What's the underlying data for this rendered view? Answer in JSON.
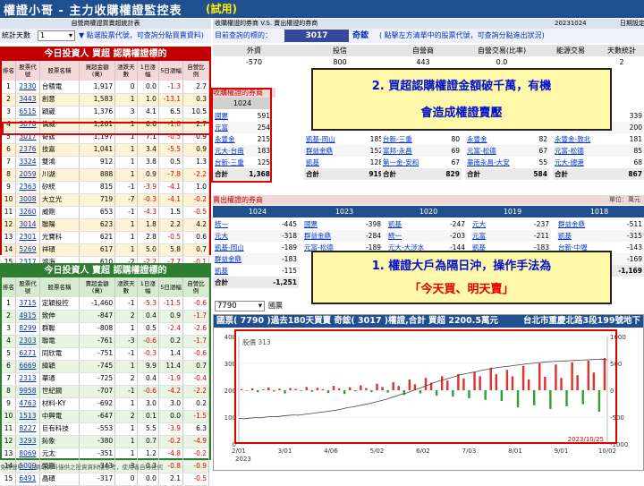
{
  "app": {
    "title": "權證小哥 - 主力收購權證監控表",
    "status_tag": "(試用)"
  },
  "left": {
    "subheader": "自營商權證買賣超統計表",
    "stat_days_label": "統計天數",
    "stat_days_value": "1",
    "hint": "點選股票代號，可查詢分點買賣資料)",
    "buy_panel": {
      "title": "今日投資人 買超 認購權證標的",
      "headers": [
        "排名",
        "股票代號",
        "股票名稱",
        "買超金額(萬)",
        "漲跌天數",
        "1日漲幅",
        "5日漲幅",
        "自營比例"
      ],
      "rows": [
        [
          "1",
          "2330",
          "台積電",
          "1,917",
          "0",
          "0.0",
          "-1.3",
          "2.7"
        ],
        [
          "2",
          "3443",
          "創意",
          "1,583",
          "1",
          "1.0",
          "-13.1",
          "0.3"
        ],
        [
          "3",
          "6515",
          "穎崴",
          "1,376",
          "3",
          "4.1",
          "6.5",
          "10.5"
        ],
        [
          "4",
          "3078",
          "僑威",
          "1,261",
          "1",
          "6.6",
          "-1.8",
          "2.7"
        ],
        [
          "5",
          "3017",
          "奇鋐",
          "1,197",
          "1",
          "7.1",
          "-0.5",
          "0.9"
        ],
        [
          "6",
          "2376",
          "技嘉",
          "1,041",
          "1",
          "3.4",
          "-5.5",
          "0.9"
        ],
        [
          "7",
          "3324",
          "雙鴻",
          "912",
          "1",
          "3.8",
          "0.5",
          "1.3"
        ],
        [
          "8",
          "2059",
          "川湖",
          "888",
          "1",
          "0.9",
          "-7.8",
          "-2.2"
        ],
        [
          "9",
          "2363",
          "矽統",
          "815",
          "-1",
          "-3.9",
          "-4.1",
          "1.0"
        ],
        [
          "10",
          "3008",
          "大立光",
          "719",
          "-7",
          "-0.3",
          "-4.1",
          "-0.2"
        ],
        [
          "11",
          "3260",
          "威剛",
          "653",
          "-1",
          "-4.3",
          "1.5",
          "-0.5"
        ],
        [
          "12",
          "3014",
          "聯陽",
          "623",
          "1",
          "1.8",
          "2.2",
          "4.2"
        ],
        [
          "13",
          "2301",
          "光寶科",
          "621",
          "1",
          "2.8",
          "-0.5",
          "0.6"
        ],
        [
          "14",
          "5269",
          "祥碩",
          "617",
          "1",
          "5.0",
          "5.8",
          "0.7"
        ],
        [
          "15",
          "2317",
          "鴻海",
          "610",
          "-2",
          "-2.2",
          "-7.7",
          "-0.1"
        ]
      ]
    },
    "sell_panel": {
      "title": "今日投資人 賣超 認購權證標的",
      "headers": [
        "排名",
        "股票代號",
        "股票名稱",
        "賣超金額(萬)",
        "漲跌天數",
        "1日漲幅",
        "5日漲幅",
        "自營比例"
      ],
      "rows": [
        [
          "1",
          "3715",
          "定穎投控",
          "-1,460",
          "-1",
          "-5.3",
          "-11.5",
          "-0.6"
        ],
        [
          "2",
          "4915",
          "致伸",
          "-847",
          "2",
          "0.4",
          "0.9",
          "-1.7"
        ],
        [
          "3",
          "8299",
          "群聯",
          "-808",
          "1",
          "0.5",
          "-2.4",
          "-2.6"
        ],
        [
          "4",
          "2303",
          "聯電",
          "-761",
          "-3",
          "-0.6",
          "0.2",
          "-1.7"
        ],
        [
          "5",
          "6271",
          "同欣電",
          "-751",
          "-1",
          "-0.3",
          "1.4",
          "-0.6"
        ],
        [
          "6",
          "6669",
          "緯穎",
          "-745",
          "1",
          "9.9",
          "11.4",
          "0.7"
        ],
        [
          "7",
          "2313",
          "華通",
          "-725",
          "2",
          "0.4",
          "-1.9",
          "-0.4"
        ],
        [
          "8",
          "9958",
          "世紀鋼",
          "-707",
          "-1",
          "-0.6",
          "-4.2",
          "-2.2"
        ],
        [
          "9",
          "4763",
          "材料-KY",
          "-692",
          "1",
          "3.0",
          "3.0",
          "0.2"
        ],
        [
          "10",
          "1513",
          "中興電",
          "-647",
          "2",
          "0.1",
          "0.0",
          "-1.5"
        ],
        [
          "11",
          "8227",
          "巨有科技",
          "-553",
          "1",
          "5.5",
          "-3.9",
          "6.3"
        ],
        [
          "12",
          "3293",
          "鈊象",
          "-380",
          "1",
          "0.7",
          "-0.2",
          "-4.9"
        ],
        [
          "13",
          "8069",
          "元太",
          "-351",
          "1",
          "1.2",
          "-4.8",
          "-0.2"
        ],
        [
          "14",
          "5009",
          "榮剛",
          "-343",
          "3",
          "0.3",
          "-0.8",
          "-0.9"
        ],
        [
          "15",
          "6491",
          "晶碩",
          "-317",
          "0",
          "0.0",
          "2.1",
          "-0.5"
        ]
      ]
    },
    "disclaimer": "免責聲明：此網站資料僅供之投資資料僅參考，使用者自行任何"
  },
  "right": {
    "subheader": "收購權證的券商 V.S. 賣出權證的券商",
    "date_label": "日期設定",
    "date_value": "20231024",
    "query_label": "目前查詢的標的：",
    "query_code": "3017",
    "query_name": "奇鋐",
    "query_hint": "( 點擊左方清單中的股票代號，可查詢分點進出狀況)",
    "summary_headers": [
      "外資",
      "投信",
      "自營商",
      "自營交易(比率)",
      "能源交易",
      "天數統計"
    ],
    "summary_values": [
      "-570",
      "800",
      "443",
      "0.0",
      "",
      "2"
    ],
    "buy_section_label": "收購權證的券商",
    "buy_dates": [
      "1024",
      "1023",
      "1020",
      "1019",
      "1018"
    ],
    "buy_col1": [
      [
        "國票",
        "591"
      ],
      [
        "元富",
        "254"
      ],
      [
        "永豐金",
        "215"
      ],
      [
        "元大-台南",
        "183"
      ],
      [
        "台新-三重",
        "125"
      ]
    ],
    "buy_col1_total": [
      "合計",
      "1,368"
    ],
    "buy_col2": [
      [
        "凱基-岡山",
        "185"
      ],
      [
        "群益金鼎",
        "152"
      ],
      [
        "凱基",
        "128"
      ]
    ],
    "buy_col2_total": [
      "合計",
      "919"
    ],
    "buy_col3": [
      [
        "台新-三重",
        "80"
      ],
      [
        "富邦-永昌",
        "69"
      ],
      [
        "第一金-安和",
        "67"
      ]
    ],
    "buy_col3_total": [
      "合計",
      "829"
    ],
    "buy_col4": [
      [
        "永豐金",
        "82"
      ],
      [
        "元富-松德",
        "67"
      ],
      [
        "華南永昌-大安",
        "55"
      ]
    ],
    "buy_col4_total": [
      "合計",
      "584"
    ],
    "buy_col5": [
      [
        "",
        "339"
      ],
      [
        "",
        "200"
      ],
      [
        "永豐金-敦北",
        "181"
      ],
      [
        "元富-松德",
        "85"
      ],
      [
        "元大-總港",
        "68"
      ]
    ],
    "buy_col5_total": [
      "合計",
      "867"
    ],
    "sell_section_label": "賣出權證的券商",
    "sell_unit": "單位：萬元",
    "sell_col1": [
      [
        "統一",
        "-445"
      ],
      [
        "元大",
        "-318"
      ],
      [
        "凱基-岡山",
        "-189"
      ],
      [
        "群益金鼎",
        "-183"
      ],
      [
        "凱基",
        "-115"
      ]
    ],
    "sell_col1_total": [
      "合計",
      "-1,251"
    ],
    "sell_col2": [
      [
        "國票",
        "-398"
      ],
      [
        "群益金鼎",
        "-284"
      ],
      [
        "元富-松德",
        "-189"
      ]
    ],
    "sell_col3": [
      [
        "凱基",
        "-247"
      ],
      [
        "統一",
        "-203"
      ],
      [
        "元大-大涉水",
        "-144"
      ]
    ],
    "sell_col4": [
      [
        "元大",
        "-237"
      ],
      [
        "元富",
        "-211"
      ],
      [
        "凱基",
        "-183"
      ]
    ],
    "sell_col5": [
      [
        "群益金鼎",
        "-511"
      ],
      [
        "凱基",
        "-315"
      ],
      [
        "台新-中壢",
        "-143"
      ],
      [
        "",
        "-169"
      ]
    ],
    "sell_col5_total": [
      "",
      "-1,169"
    ]
  },
  "chart": {
    "code_input": "7790",
    "code_suffix": "國票",
    "title": "國票( 7790 )過去180天買賣 奇鋐( 3017 )權證,合計  買超 2200.5萬元",
    "broker_address": "台北市重慶北路3段199號地下",
    "legend": "股價 313",
    "date_stamp": "2023/10/25",
    "year_label": "2023",
    "chart_data": {
      "type": "bar",
      "x_ticks": [
        "2/01",
        "3/01",
        "4/06",
        "5/02",
        "6/02",
        "7/03",
        "8/01",
        "9/01",
        "10/02"
      ],
      "y_left_ticks": [
        400,
        300,
        200,
        100,
        0
      ],
      "y_left_range": [
        0,
        400
      ],
      "y_right_ticks": [
        1000,
        500,
        0,
        -500,
        -1000
      ],
      "y_right_range": [
        -1000,
        1000
      ],
      "series": [
        {
          "name": "股價 313",
          "type": "line"
        }
      ],
      "values": [
        20,
        -10,
        35,
        -40,
        15,
        50,
        -25,
        30,
        -60,
        40,
        25,
        -15,
        60,
        -30,
        45,
        20,
        -50,
        80,
        35,
        -70,
        55,
        -20,
        90,
        40,
        -35,
        120,
        60,
        -45,
        150,
        80,
        -90,
        200,
        110,
        -60,
        230,
        140,
        -100,
        260,
        180,
        -120,
        300,
        220,
        -150,
        340,
        260,
        -180,
        420,
        300,
        -200,
        380,
        260,
        -320,
        450,
        200,
        -280,
        500,
        250,
        -350,
        480,
        230,
        -300,
        520,
        280,
        -260,
        550,
        330,
        -400,
        600
      ],
      "price": [
        95,
        94,
        96,
        98,
        97,
        100,
        102,
        101,
        104,
        106,
        108,
        107,
        110,
        112,
        115,
        118,
        120,
        123,
        126,
        130,
        135,
        138,
        142,
        146,
        150,
        155,
        160,
        165,
        172,
        178,
        185,
        190,
        198,
        205,
        212,
        220,
        228,
        235,
        240,
        246,
        252,
        258,
        262,
        266,
        270,
        275,
        278,
        282,
        285,
        288,
        290,
        293,
        295,
        298,
        300,
        302,
        304,
        306,
        307,
        308,
        309,
        310,
        311,
        312,
        313,
        314,
        315,
        316,
        313
      ]
    }
  },
  "callouts": {
    "c2_line1": "2.  買超認購權證金額破千萬，有機",
    "c2_line2": "會造成權證賣壓",
    "c1_line1": "1.  權證大戶為隔日沖，操作手法為",
    "c1_line2": "「今天買、明天賣」"
  },
  "colors": {
    "brand": "#1f4f8f",
    "buy_panel": "#c00000",
    "sell_panel": "#2e7d32",
    "highlight": "#e00000"
  }
}
